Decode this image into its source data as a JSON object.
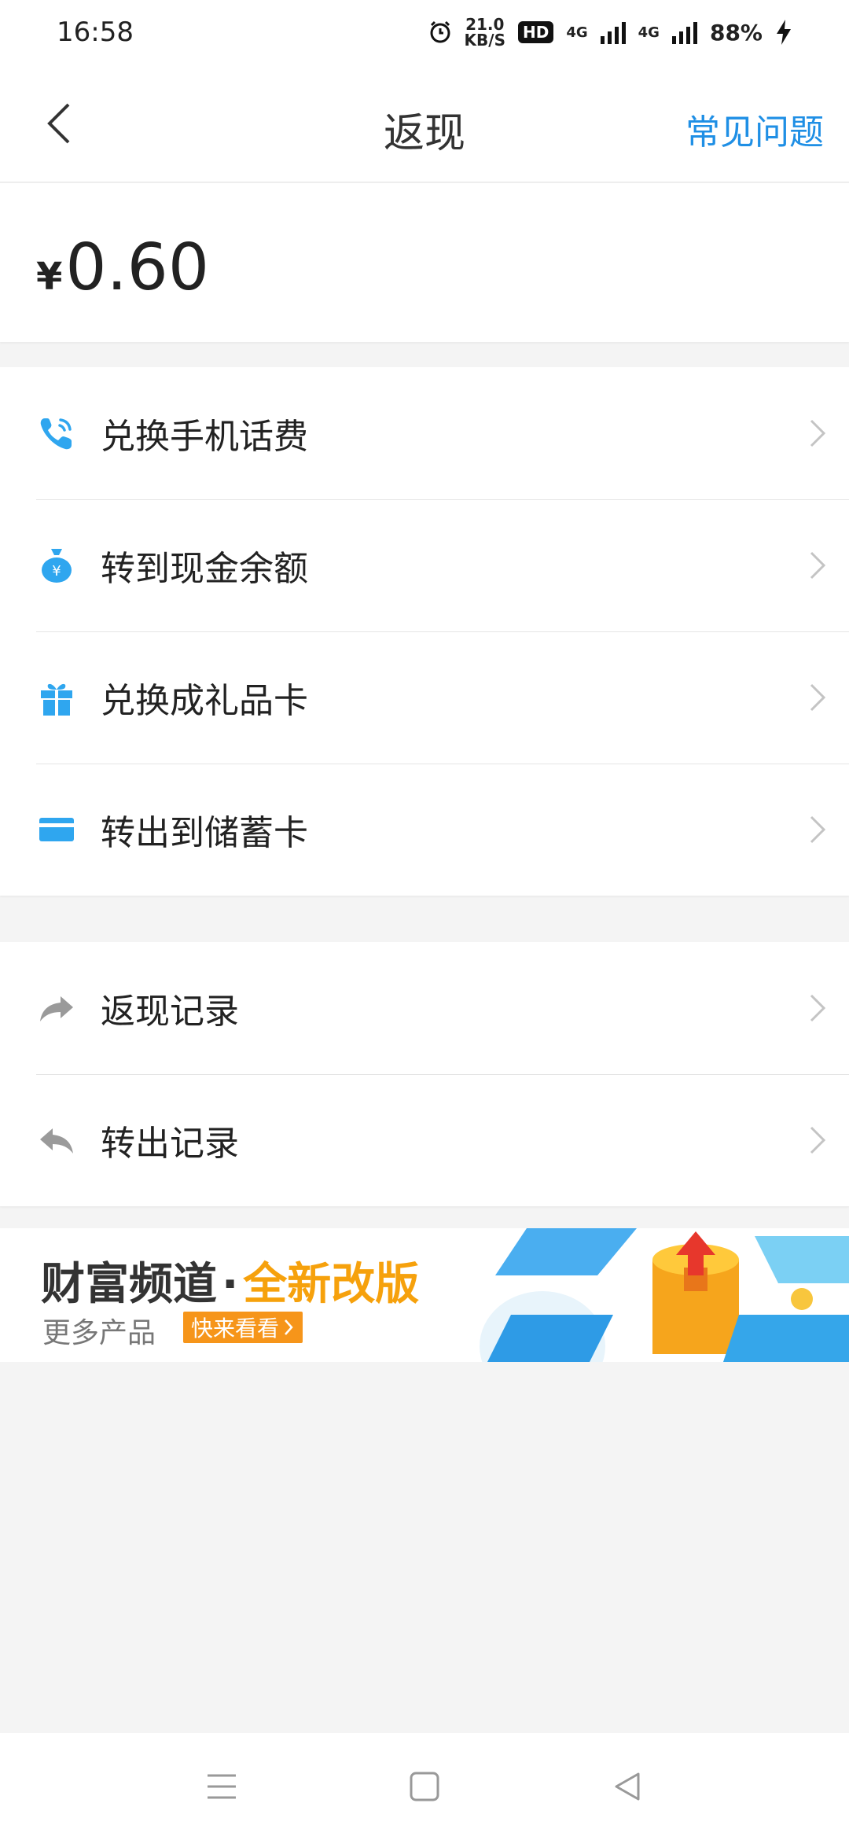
{
  "status_bar": {
    "time": "16:58",
    "net_speed_value": "21.0",
    "net_speed_unit": "KB/S",
    "hd_badge": "HD",
    "network_1": "4G",
    "network_2": "4G",
    "battery": "88%"
  },
  "header": {
    "title": "返现",
    "faq_label": "常见问题"
  },
  "balance": {
    "currency_symbol": "¥",
    "amount": "0.60"
  },
  "actions": {
    "items": [
      {
        "label": "兑换手机话费",
        "icon": "phone-icon"
      },
      {
        "label": "转到现金余额",
        "icon": "money-bag-icon"
      },
      {
        "label": "兑换成礼品卡",
        "icon": "gift-icon"
      },
      {
        "label": "转出到储蓄卡",
        "icon": "card-icon"
      }
    ]
  },
  "records": {
    "items": [
      {
        "label": "返现记录",
        "icon": "forward-arrow-icon"
      },
      {
        "label": "转出记录",
        "icon": "reply-arrow-icon"
      }
    ]
  },
  "banner": {
    "title_main": "财富频道",
    "title_dot": "·",
    "title_accent": "全新改版",
    "subtitle": "更多产品",
    "cta": "快来看看"
  },
  "colors": {
    "accent_blue": "#1f8fe5",
    "icon_blue": "#2fa6ef",
    "banner_orange": "#f6951a"
  }
}
